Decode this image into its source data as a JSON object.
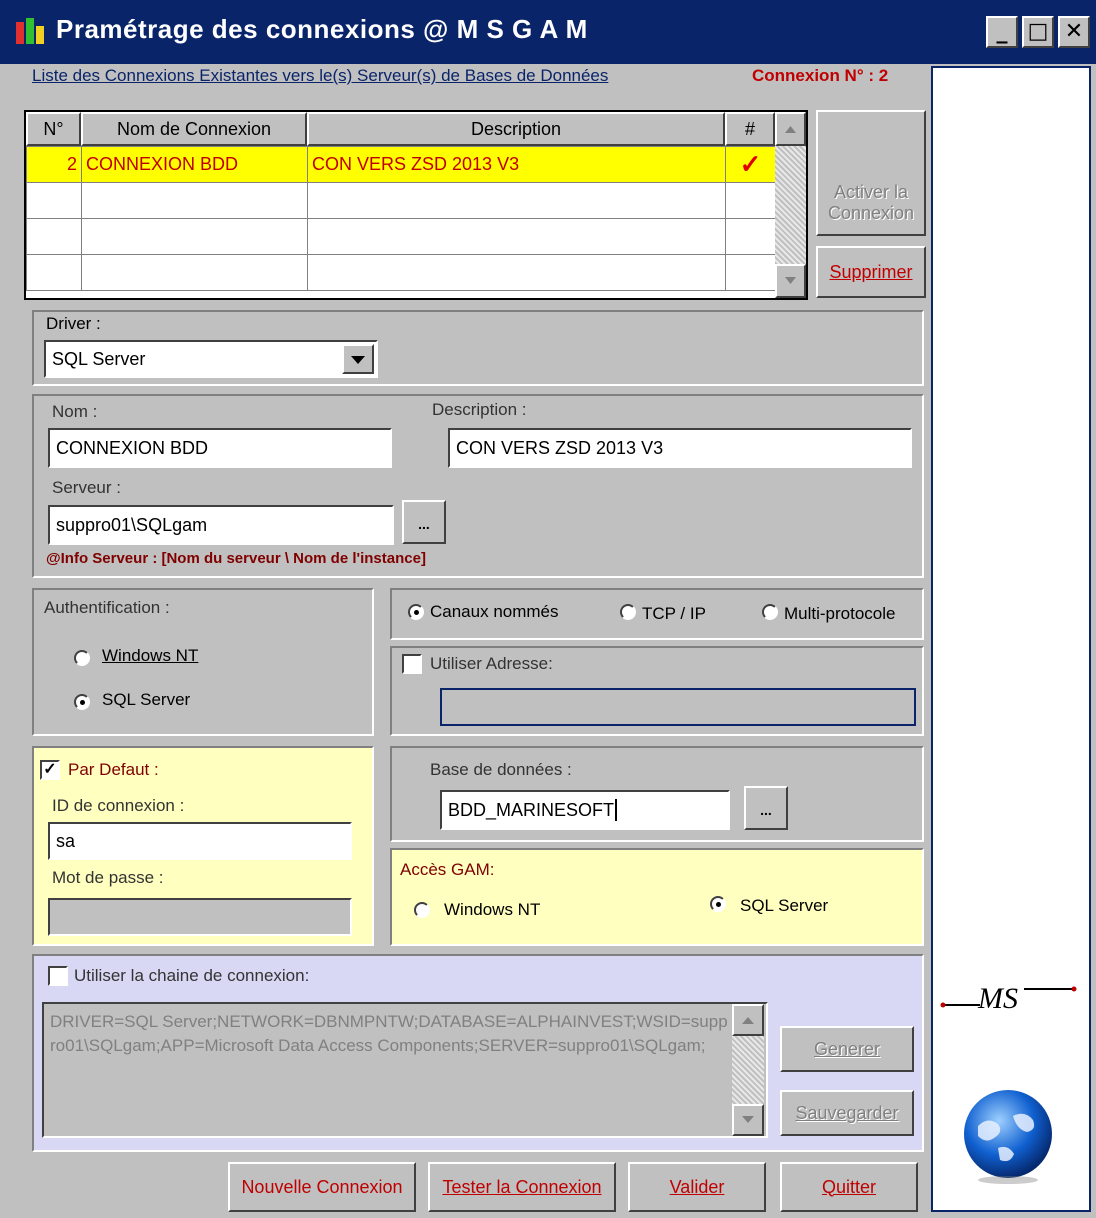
{
  "window": {
    "title": "Pramétrage des connexions @ M S   G A M"
  },
  "header": {
    "list_link": "Liste des Connexions Existantes vers le(s) Serveur(s) de Bases de Données",
    "connection_number": "Connexion N° : 2"
  },
  "table": {
    "columns": [
      "N°",
      "Nom de Connexion",
      "Description",
      "#"
    ],
    "rows": [
      {
        "num": "2",
        "name": "CONNEXION BDD",
        "description": "CON VERS ZSD 2013 V3",
        "active": "✓"
      },
      {
        "num": "",
        "name": "",
        "description": "",
        "active": ""
      },
      {
        "num": "",
        "name": "",
        "description": "",
        "active": ""
      },
      {
        "num": "",
        "name": "",
        "description": "",
        "active": ""
      }
    ]
  },
  "buttons": {
    "activate_l1": "Activer la",
    "activate_l2": "Connexion",
    "delete": "Supprimer",
    "browse": "...",
    "generate": "Generer",
    "save": "Sauvegarder",
    "new_connection": "Nouvelle Connexion",
    "test_connection": "Tester la Connexion",
    "validate": "Valider",
    "quit": "Quitter"
  },
  "driver": {
    "label": "Driver :",
    "value": "SQL Server"
  },
  "connection": {
    "name_label": "Nom :",
    "name_value": "CONNEXION BDD",
    "description_label": "Description :",
    "description_value": "CON VERS ZSD 2013 V3",
    "server_label": "Serveur :",
    "server_value": "suppro01\\SQLgam",
    "info": "@Info  Serveur : [Nom du serveur \\ Nom de l'instance]"
  },
  "auth": {
    "label": "Authentification :",
    "windows_nt": "Windows NT",
    "sql_server": "SQL Server",
    "selected": "sql_server"
  },
  "protocol": {
    "named_pipes": "Canaux nommés",
    "tcp_ip": "TCP / IP",
    "multi": "Multi-protocole",
    "selected": "named_pipes"
  },
  "address": {
    "label": "Utiliser Adresse:",
    "checked": false,
    "value": ""
  },
  "defaults": {
    "label": "Par Defaut :",
    "checked": true,
    "id_label": "ID de connexion :",
    "id_value": "sa",
    "password_label": "Mot de passe :",
    "password_value": ""
  },
  "database": {
    "label": "Base de données :",
    "value": "BDD_MARINESOFT"
  },
  "gam_access": {
    "label": "Accès GAM:",
    "windows_nt": "Windows NT",
    "sql_server": "SQL Server",
    "selected": "sql_server"
  },
  "conn_string": {
    "label": "Utiliser la chaine de connexion:",
    "checked": false,
    "value": "DRIVER=SQL Server;NETWORK=DBNMPNTW;DATABASE=ALPHAINVEST;WSID=suppro01\\SQLgam;APP=Microsoft Data Access Components;SERVER=suppro01\\SQLgam;"
  },
  "logo": {
    "text": "MS"
  },
  "colors": {
    "title_bar": "#0a246a",
    "accent_red": "#c00000",
    "selected_row": "#ffff00",
    "yellow_panel": "#ffffc0",
    "lavender_panel": "#d8d8f4"
  }
}
